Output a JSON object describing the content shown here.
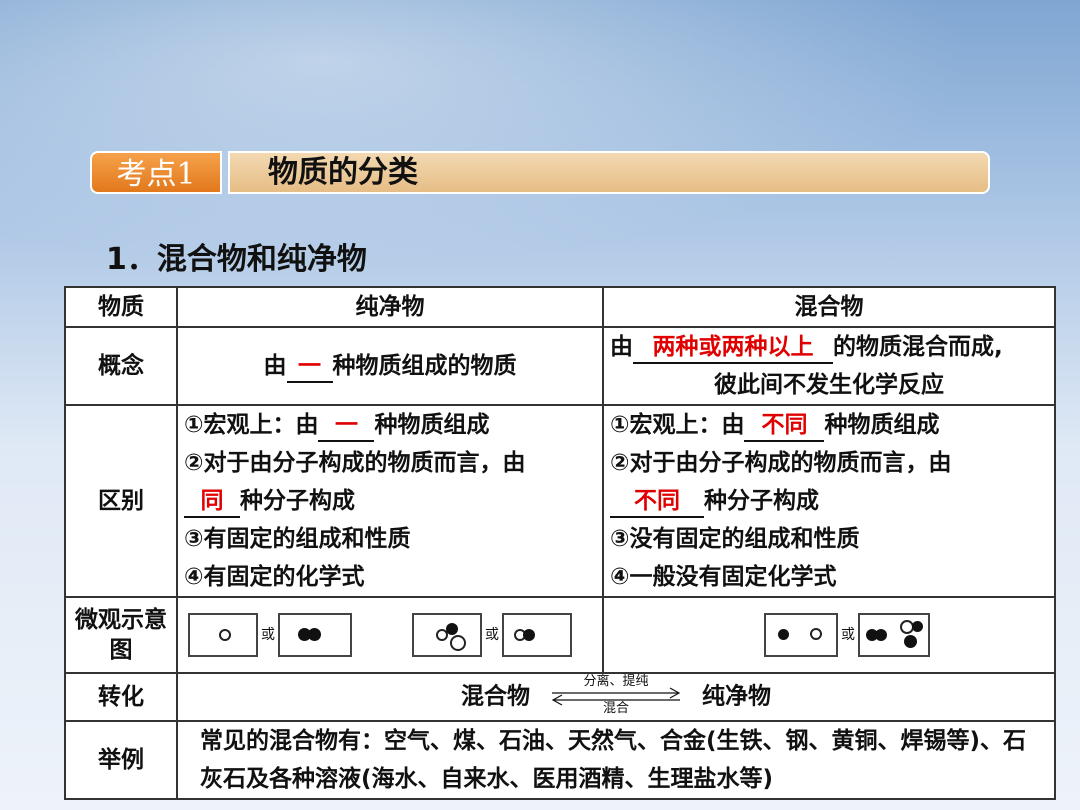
{
  "header": {
    "tag": "考点1",
    "title": "物质的分类"
  },
  "section_title": "1．混合物和纯净物",
  "table": {
    "headers": [
      "物质",
      "纯净物",
      "混合物"
    ],
    "concept": {
      "label": "概念",
      "pure": {
        "pre": "由",
        "blank": "一",
        "post": "种物质组成的物质"
      },
      "mixture": {
        "pre": "由",
        "blank": "两种或两种以上",
        "post": "的物质混合而成,",
        "line2": "彼此间不发生化学反应"
      }
    },
    "difference": {
      "label": "区别",
      "pure": {
        "l1_pre": "①宏观上：由",
        "l1_blank": "一",
        "l1_post": "种物质组成",
        "l2": "②对于由分子构成的物质而言，由",
        "l3_blank": "同",
        "l3_post": "种分子构成",
        "l4": "③有固定的组成和性质",
        "l5": "④有固定的化学式"
      },
      "mixture": {
        "l1_pre": "①宏观上：由",
        "l1_blank": "不同",
        "l1_post": "种物质组成",
        "l2": "②对于由分子构成的物质而言，由",
        "l3_blank": "不同",
        "l3_post": "种分子构成",
        "l4": "③没有固定的组成和性质",
        "l5": "④一般没有固定化学式"
      }
    },
    "micro": {
      "label": "微观示意图",
      "or": "或"
    },
    "conversion": {
      "label": "转化",
      "left": "混合物",
      "right": "纯净物",
      "arrow_top": "分离、提纯",
      "arrow_bottom": "混合"
    },
    "examples": {
      "label": "举例",
      "text": "常见的混合物有：空气、煤、石油、天然气、合金(生铁、钢、黄铜、焊锡等)、石灰石及各种溶液(海水、自来水、医用酒精、生理盐水等)"
    }
  },
  "colors": {
    "blank_answer": "#e00000",
    "tag_orange": "#e2781c",
    "bar_tan": "#e6bd85"
  }
}
